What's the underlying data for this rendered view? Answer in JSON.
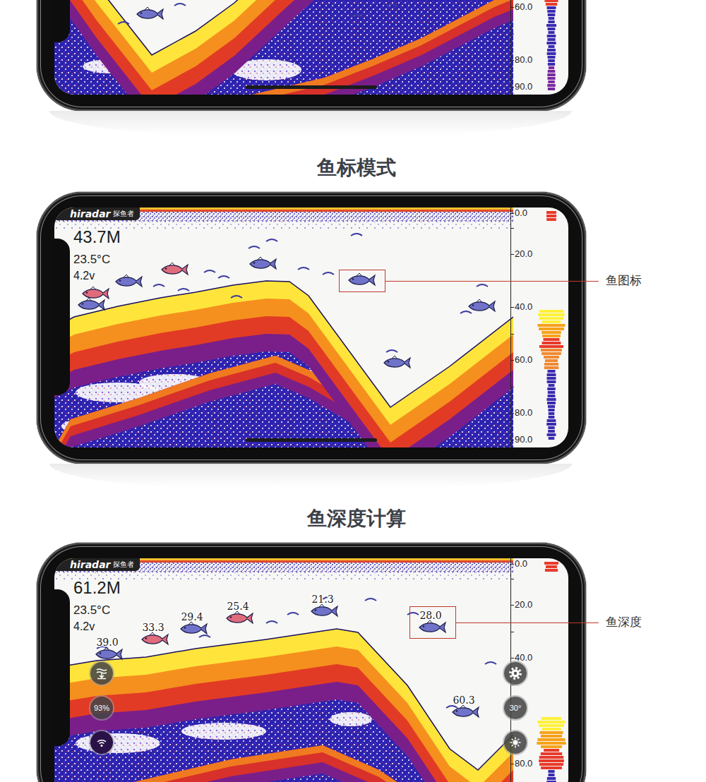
{
  "sections": [
    {
      "heading": null,
      "callout": null,
      "screen": {
        "logo": null,
        "readings": [],
        "scale": [
          "60.0",
          "80.0",
          "90.0"
        ],
        "fish": [
          {
            "color": "#7073c9",
            "depth": null,
            "boxed": false
          }
        ],
        "controls": null
      }
    },
    {
      "heading": "鱼标模式",
      "callout": {
        "label": "鱼图标"
      },
      "screen": {
        "logo": {
          "brand": "hiradar",
          "sub": "探鱼者"
        },
        "readings": [
          "43.7M",
          "23.5°C",
          "4.2v"
        ],
        "scale": [
          "0.0",
          "20.0",
          "40.0",
          "60.0",
          "80.0",
          "90.0"
        ],
        "fish": [
          {
            "color": "#e06b7b",
            "depth": null,
            "boxed": false
          },
          {
            "color": "#7073c9",
            "depth": null,
            "boxed": false
          },
          {
            "color": "#7073c9",
            "depth": null,
            "boxed": false
          },
          {
            "color": "#e06b7b",
            "depth": null,
            "boxed": false
          },
          {
            "color": "#7073c9",
            "depth": null,
            "boxed": false
          },
          {
            "color": "#7073c9",
            "depth": null,
            "boxed": true
          },
          {
            "color": "#7073c9",
            "depth": null,
            "boxed": false
          },
          {
            "color": "#7073c9",
            "depth": null,
            "boxed": false
          }
        ],
        "controls": null
      }
    },
    {
      "heading": "鱼深度计算",
      "callout": {
        "label": "鱼深度"
      },
      "screen": {
        "logo": {
          "brand": "hiradar",
          "sub": "探鱼者"
        },
        "readings": [
          "61.2M",
          "23.5°C",
          "4.2v"
        ],
        "scale": [
          "0.0",
          "20.0",
          "40.0",
          "80.0"
        ],
        "fish": [
          {
            "color": "#7073c9",
            "depth": "39.0",
            "boxed": false
          },
          {
            "color": "#e06b7b",
            "depth": "33.3",
            "boxed": false
          },
          {
            "color": "#7073c9",
            "depth": "29.4",
            "boxed": false
          },
          {
            "color": "#e06b7b",
            "depth": "25.4",
            "boxed": false
          },
          {
            "color": "#7073c9",
            "depth": "21.3",
            "boxed": false
          },
          {
            "color": "#7073c9",
            "depth": "28.0",
            "boxed": true
          },
          {
            "color": "#7073c9",
            "depth": "60.3",
            "boxed": false
          }
        ],
        "controls": {
          "left": [
            {
              "kind": "icon"
            },
            {
              "kind": "badge",
              "label": "93%"
            },
            {
              "kind": "icon"
            }
          ],
          "right": [
            {
              "kind": "icon"
            },
            {
              "kind": "badge",
              "label": "30°"
            },
            {
              "kind": "icon"
            }
          ]
        }
      }
    }
  ]
}
